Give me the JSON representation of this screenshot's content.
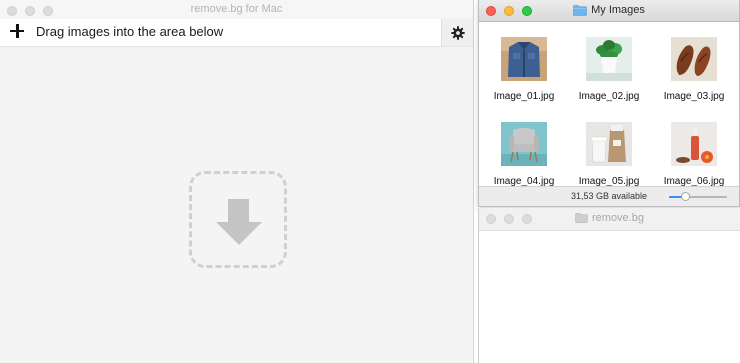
{
  "main_window": {
    "title": "remove.bg for Mac",
    "toolbar": {
      "add_icon": "plus-icon",
      "instruction": "Drag images into the area below",
      "settings_icon": "gear-icon"
    },
    "dropzone_icon": "download-arrow-icon"
  },
  "finder_window": {
    "title": "My Images",
    "folder_icon": "folder-icon",
    "files": [
      {
        "name": "Image_01.jpg",
        "thumbnail": "denim-shirt"
      },
      {
        "name": "Image_02.jpg",
        "thumbnail": "potted-plant"
      },
      {
        "name": "Image_03.jpg",
        "thumbnail": "brown-shoes"
      },
      {
        "name": "Image_04.jpg",
        "thumbnail": "armchair"
      },
      {
        "name": "Image_05.jpg",
        "thumbnail": "coffee-packaging"
      },
      {
        "name": "Image_06.jpg",
        "thumbnail": "cosmetics-bottle"
      }
    ],
    "status": "31,53 GB available",
    "icon_size_slider": 0.25
  },
  "second_window": {
    "title": "remove.bg",
    "folder_icon": "folder-icon"
  },
  "colors": {
    "close": "#fc605c",
    "minimize": "#fdbc40",
    "zoom": "#34c84a",
    "accent": "#3b8cf6",
    "folder": "#6fb6ee"
  }
}
